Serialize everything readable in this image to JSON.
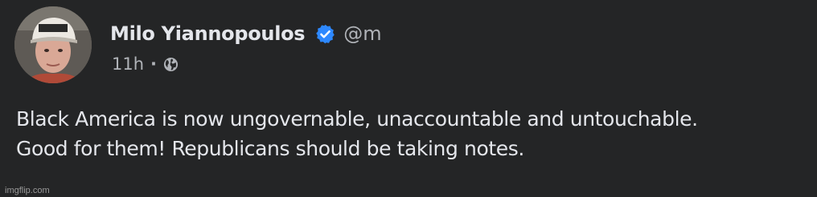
{
  "post": {
    "author_name": "Milo Yiannopoulos",
    "handle": "@m",
    "timestamp": "11h",
    "separator": "·",
    "audience_icon": "globe-icon",
    "verified_icon": "verified-badge-icon",
    "text_lines": [
      "Black America is now ungovernable, unaccountable and untouchable.",
      "Good for them! Republicans should be taking notes."
    ]
  },
  "watermark": "imgflip.com",
  "colors": {
    "background": "#242526",
    "primary_text": "#e4e6eb",
    "secondary_text": "#b0b3b8",
    "verified_blue": "#2d88ff"
  }
}
